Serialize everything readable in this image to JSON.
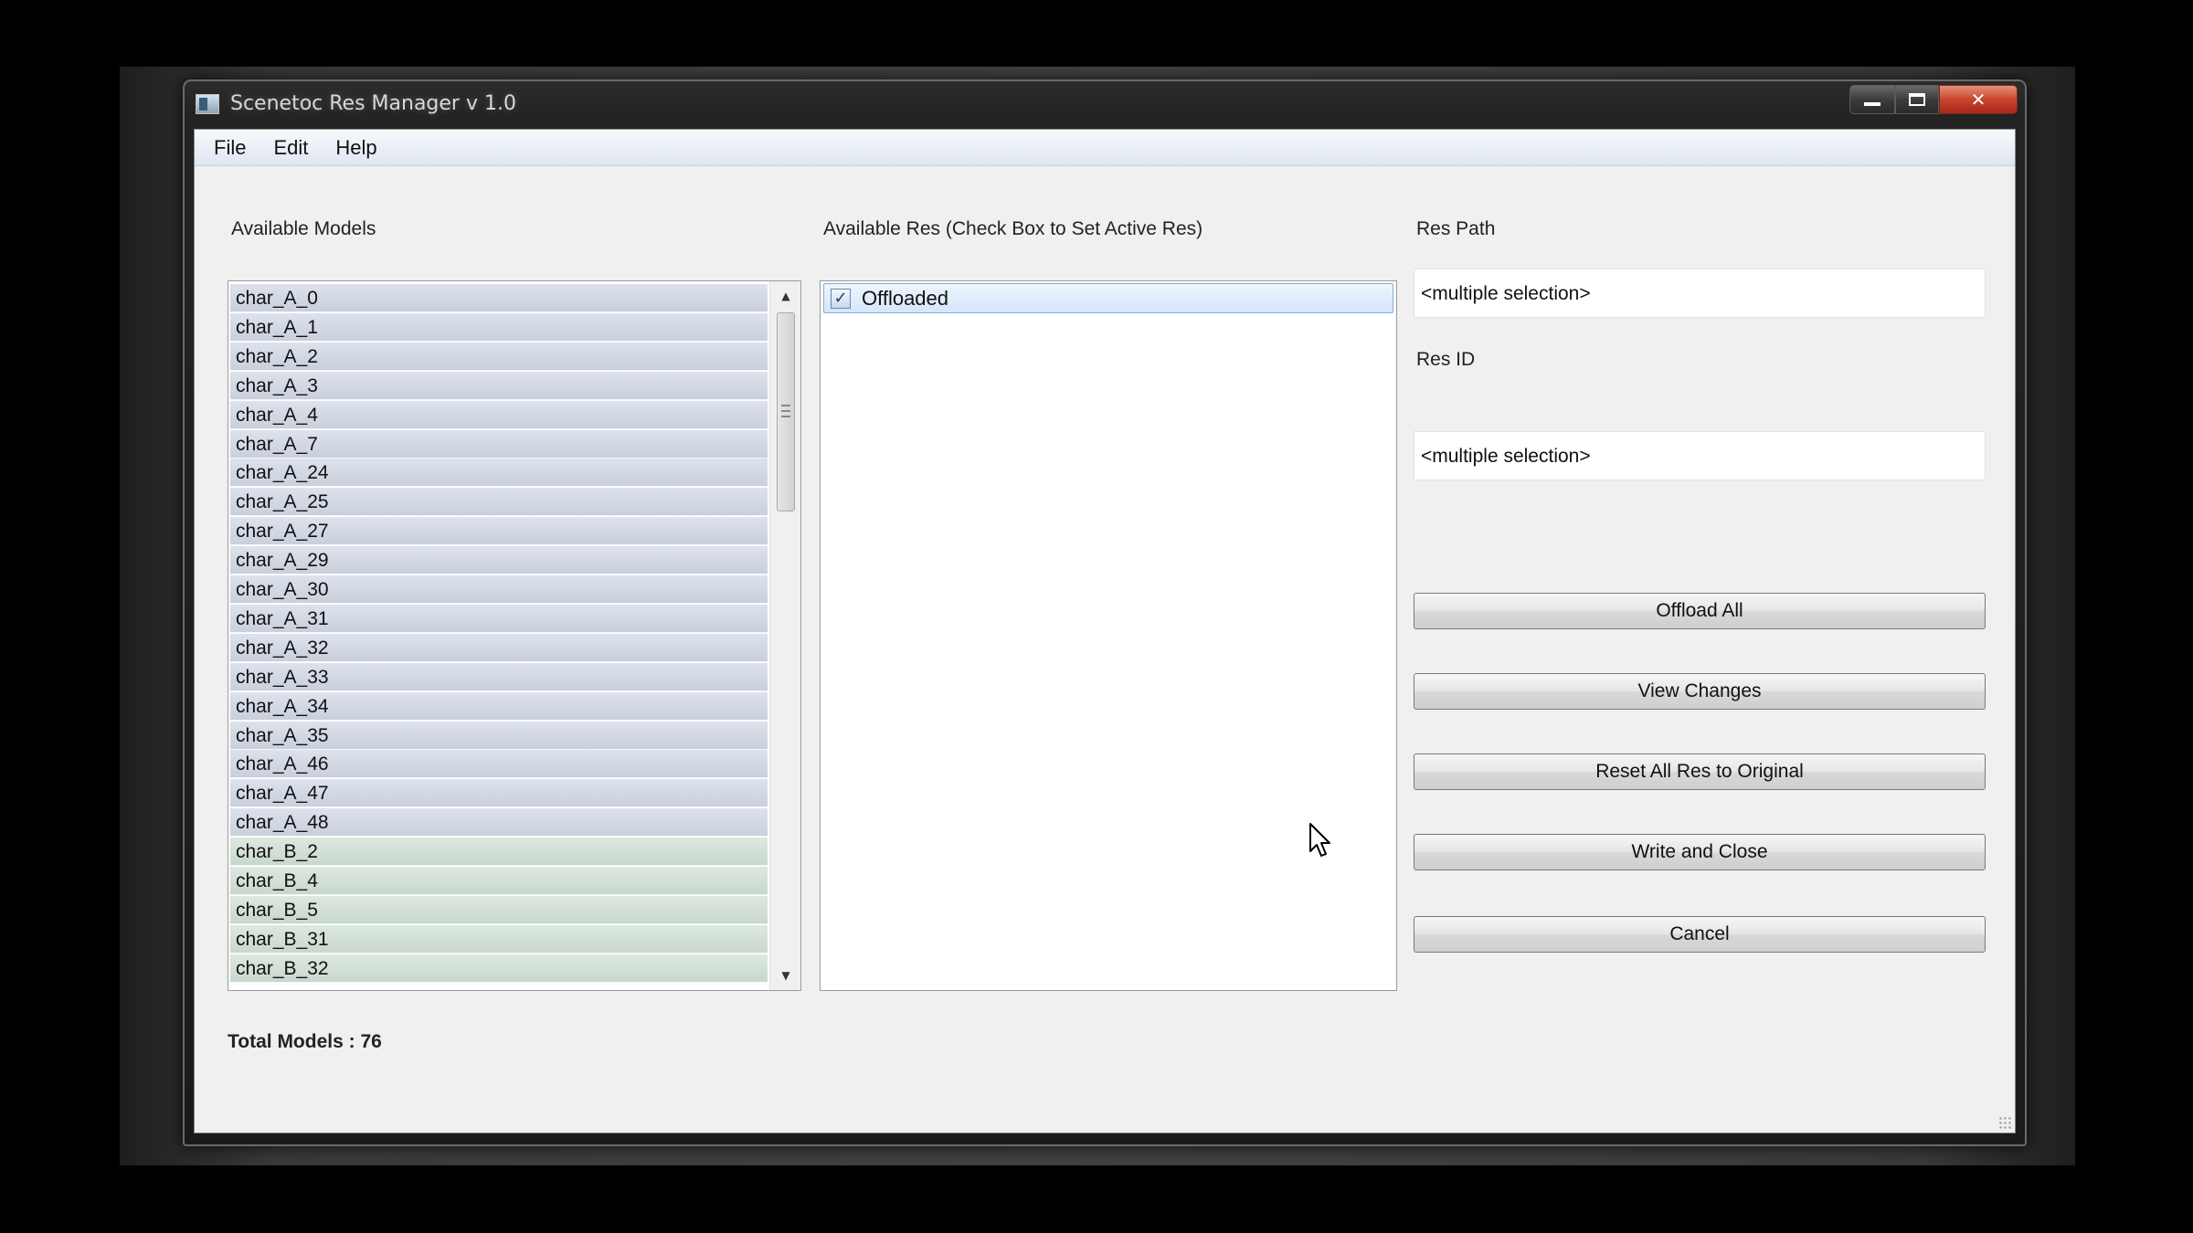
{
  "window": {
    "title": "Scenetoc Res Manager v 1.0"
  },
  "menu": [
    "File",
    "Edit",
    "Help"
  ],
  "models": {
    "label": "Available Models",
    "items": [
      {
        "name": "char_A_0",
        "group": "A"
      },
      {
        "name": "char_A_1",
        "group": "A"
      },
      {
        "name": "char_A_2",
        "group": "A"
      },
      {
        "name": "char_A_3",
        "group": "A"
      },
      {
        "name": "char_A_4",
        "group": "A"
      },
      {
        "name": "char_A_7",
        "group": "A"
      },
      {
        "name": "char_A_24",
        "group": "A"
      },
      {
        "name": "char_A_25",
        "group": "A"
      },
      {
        "name": "char_A_27",
        "group": "A"
      },
      {
        "name": "char_A_29",
        "group": "A"
      },
      {
        "name": "char_A_30",
        "group": "A"
      },
      {
        "name": "char_A_31",
        "group": "A"
      },
      {
        "name": "char_A_32",
        "group": "A"
      },
      {
        "name": "char_A_33",
        "group": "A"
      },
      {
        "name": "char_A_34",
        "group": "A"
      },
      {
        "name": "char_A_35",
        "group": "A"
      },
      {
        "name": "char_A_46",
        "group": "A"
      },
      {
        "name": "char_A_47",
        "group": "A"
      },
      {
        "name": "char_A_48",
        "group": "A"
      },
      {
        "name": "char_B_2",
        "group": "B"
      },
      {
        "name": "char_B_4",
        "group": "B"
      },
      {
        "name": "char_B_5",
        "group": "B"
      },
      {
        "name": "char_B_31",
        "group": "B"
      },
      {
        "name": "char_B_32",
        "group": "B"
      }
    ],
    "total_label": "Total Models : 76"
  },
  "res": {
    "label": "Available Res (Check Box to Set Active Res)",
    "items": [
      {
        "name": "Offloaded",
        "checked": true
      }
    ]
  },
  "res_path": {
    "label": "Res Path",
    "value": "<multiple selection>"
  },
  "res_id": {
    "label": "Res ID",
    "value": "<multiple selection>"
  },
  "buttons": {
    "offload_all": "Offload All",
    "view_changes": "View Changes",
    "reset_all": "Reset All Res to Original",
    "write_close": "Write and Close",
    "cancel": "Cancel"
  },
  "colors": {
    "row_group_a": "#d3d9e4",
    "row_group_b": "#d2e0d6",
    "selection_blue": "#d5e6fa",
    "close_red": "#c8442c"
  }
}
